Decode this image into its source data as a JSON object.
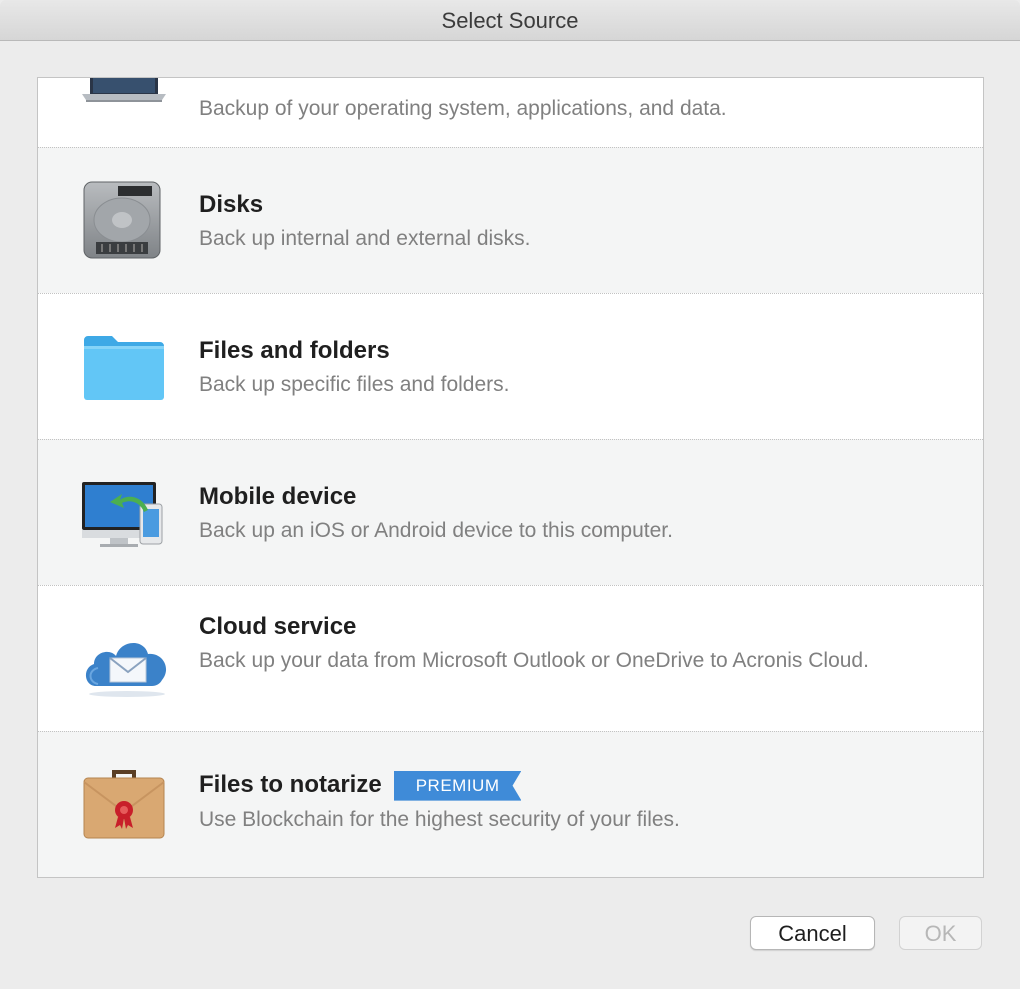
{
  "window": {
    "title": "Select Source"
  },
  "items": [
    {
      "title": "",
      "desc": "Backup of your operating system, applications, and data.",
      "icon": "laptop-icon"
    },
    {
      "title": "Disks",
      "desc": "Back up internal and external disks.",
      "icon": "hard-disk-icon"
    },
    {
      "title": "Files and folders",
      "desc": "Back up specific files and folders.",
      "icon": "folder-icon"
    },
    {
      "title": "Mobile device",
      "desc": "Back up an iOS or Android device to this computer.",
      "icon": "mobile-sync-icon"
    },
    {
      "title": "Cloud service",
      "desc": "Back up your data from Microsoft Outlook or OneDrive to Acronis Cloud.",
      "icon": "cloud-mail-icon"
    },
    {
      "title": "Files to notarize",
      "desc": "Use Blockchain for the highest security of your files.",
      "icon": "briefcase-seal-icon",
      "badge": "PREMIUM"
    }
  ],
  "buttons": {
    "cancel": "Cancel",
    "ok": "OK"
  },
  "colors": {
    "badge": "#3f8bd8",
    "folder": "#5bc4f5",
    "cloud": "#3b82c9",
    "briefcase": "#d9a872"
  }
}
